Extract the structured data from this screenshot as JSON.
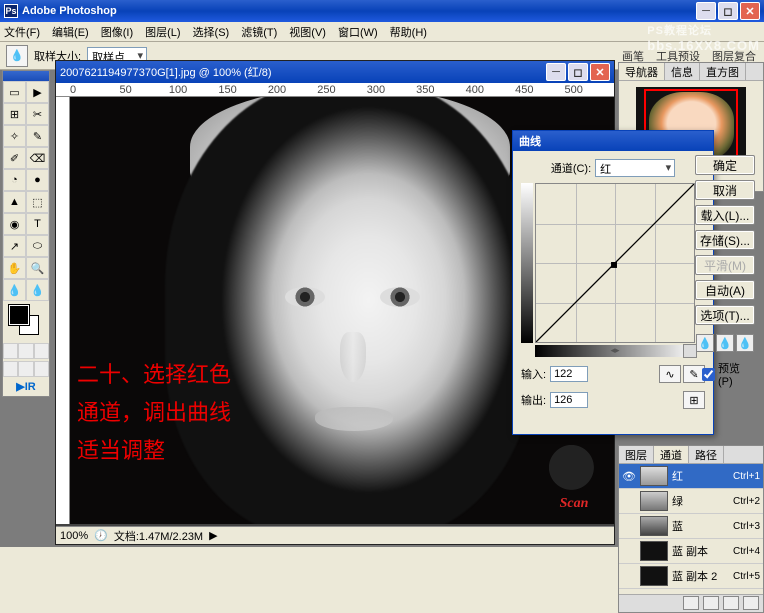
{
  "app": {
    "title": "Adobe Photoshop"
  },
  "menu": [
    "文件(F)",
    "编辑(E)",
    "图像(I)",
    "图层(L)",
    "选择(S)",
    "滤镜(T)",
    "视图(V)",
    "窗口(W)",
    "帮助(H)"
  ],
  "options": {
    "label": "取样大小:",
    "value": "取样点",
    "right": [
      "画笔",
      "工具预设",
      "图层复合"
    ]
  },
  "watermark": "PS教程论坛",
  "watermark2": "bbs.16XX8.COM",
  "doc": {
    "title": "2007621194977370G[1].jpg @ 100% (红/8)",
    "ruler": [
      "0",
      "50",
      "100",
      "150",
      "200",
      "250",
      "300",
      "350",
      "400",
      "450",
      "500"
    ],
    "zoom": "100%",
    "status": "文档:1.47M/2.23M",
    "overlay1": "二十、选择红色",
    "overlay2": "通道，调出曲线",
    "overlay3": "适当调整",
    "scan": "Scan"
  },
  "curves": {
    "title": "曲线",
    "channel_label": "通道(C):",
    "channel_value": "红",
    "input_label": "输入:",
    "input_value": "122",
    "output_label": "输出:",
    "output_value": "126"
  },
  "buttons": {
    "ok": "确定",
    "cancel": "取消",
    "load": "载入(L)...",
    "save": "存储(S)...",
    "smooth": "平滑(M)",
    "auto": "自动(A)",
    "options": "选项(T)...",
    "preview": "预览(P)"
  },
  "navigator": {
    "tabs": [
      "导航器",
      "信息",
      "直方图"
    ]
  },
  "channels": {
    "tabs": [
      "图层",
      "通道",
      "路径"
    ],
    "items": [
      {
        "name": "红",
        "shortcut": "Ctrl+1",
        "cls": "r",
        "selected": true,
        "eye": true
      },
      {
        "name": "绿",
        "shortcut": "Ctrl+2",
        "cls": "g"
      },
      {
        "name": "蓝",
        "shortcut": "Ctrl+3",
        "cls": "b"
      },
      {
        "name": "蓝 副本",
        "shortcut": "Ctrl+4",
        "cls": "d"
      },
      {
        "name": "蓝 副本 2",
        "shortcut": "Ctrl+5",
        "cls": "d"
      }
    ]
  },
  "tools": [
    "▭",
    "▶",
    "⊞",
    "✂",
    "✧",
    "✎",
    "✐",
    "⌫",
    "◔",
    "●",
    "▲",
    "⬚",
    "◉",
    "T",
    "↗",
    "⬭",
    "✋",
    "🔍",
    "💧",
    "💧"
  ]
}
